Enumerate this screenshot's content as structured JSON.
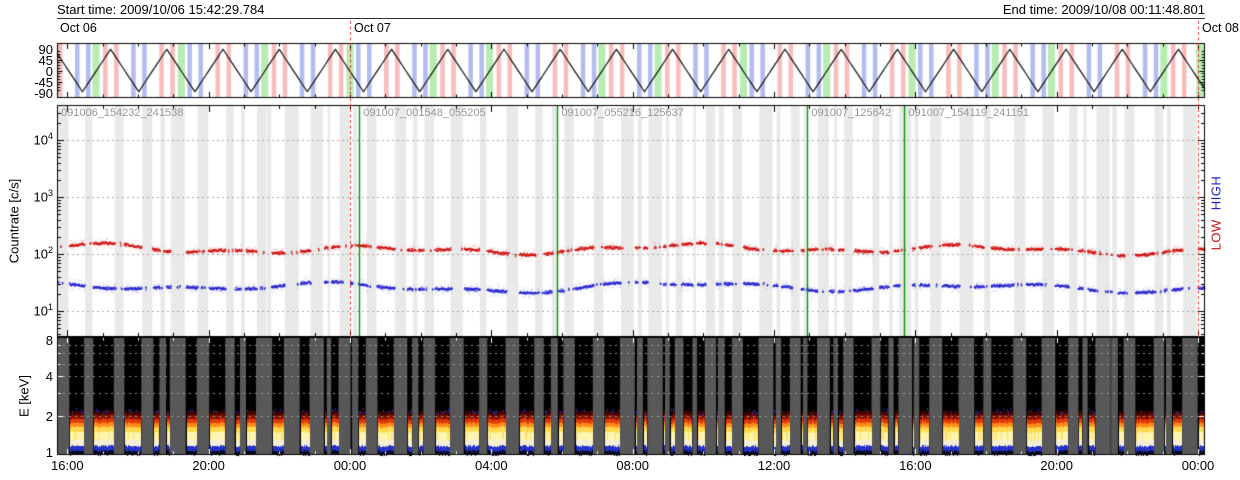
{
  "title_bar": {
    "start": "Start time: 2009/10/06 15:42:29.784",
    "end": "End time: 2009/10/08 00:11:48.801"
  },
  "legend": {
    "low": "LOW",
    "high": "HIGH",
    "low_color": "#cc1111",
    "high_color": "#2222cc"
  },
  "axis_titles": {
    "countrate": "Countrate [c/s]",
    "energy": "E [keV]"
  },
  "chart_data": {
    "type": "multi-panel-timeseries",
    "x_axis": {
      "start_time": "2009/10/06 15:42:29.784",
      "end_time": "2009/10/08 00:11:48.801",
      "total_hours": 32.4886,
      "tick_labels": [
        "16:00",
        "20:00",
        "00:00",
        "04:00",
        "08:00",
        "12:00",
        "16:00",
        "20:00",
        "00:00"
      ],
      "tick_hours": [
        0.2917,
        4.2917,
        8.2917,
        12.2917,
        16.2917,
        20.2917,
        24.2917,
        28.2917,
        32.2917
      ],
      "minor_tick_every_hours": 1,
      "start_day_label": "Oct 06",
      "day_boundaries": [
        {
          "label": "Oct 07",
          "hours": 8.2917
        },
        {
          "label": "Oct 08",
          "hours": 32.2917
        }
      ],
      "day_line_color": "#e04040"
    },
    "panels": [
      {
        "name": "scan_angle",
        "type": "line",
        "ylim": [
          -90,
          90
        ],
        "ytick_labels": [
          "90",
          "45",
          "0",
          "-45",
          "-90"
        ],
        "ytick_values": [
          90,
          45,
          0,
          -45,
          -90
        ],
        "wave": {
          "shape": "triangle",
          "amplitude_deg": 87,
          "period_hours": 1.5905,
          "first_peak_hour": -0.0736,
          "color": "#111111"
        },
        "band_colors": {
          "blue": "#b3bcef",
          "pink": "#f8bcbc",
          "green": "#b9ecb2"
        },
        "edge_band": {
          "color": "green",
          "from_hour": 32.24,
          "to_hour": 32.4886
        }
      },
      {
        "name": "countrate",
        "type": "scatter",
        "yscale": "log",
        "ytick_base": "10",
        "ytick_exponents": [
          "4",
          "3",
          "2",
          "1"
        ],
        "series": [
          {
            "name": "LOW",
            "color": "#d01414",
            "mean_level_cps": 125
          },
          {
            "name": "HIGH",
            "color": "#2424d0",
            "mean_level_cps": 27
          }
        ],
        "gap_color": "#e9e9e9",
        "grid_color": "#aaaaaa",
        "file_line_color": "#009400",
        "file_intervals": [
          {
            "label": "091006_154232_241538",
            "start_hours": 0
          },
          {
            "label": "091007_001548_055205",
            "start_hours": 8.5551
          },
          {
            "label": "091007_055216_125637",
            "start_hours": 14.1628
          },
          {
            "label": "091007_125642",
            "start_hours": 21.2367
          },
          {
            "label": "091007_154119_241151",
            "start_hours": 23.9803
          }
        ],
        "file_label_color": "#999999"
      },
      {
        "name": "spectrogram",
        "type": "heatmap",
        "ylim_kev": [
          1,
          8
        ],
        "ytick_labels": [
          "8",
          "4",
          "2",
          "1"
        ],
        "ytick_values": [
          8,
          4,
          2,
          1
        ],
        "emission_band_kev": [
          1.1,
          2.1
        ],
        "background": "#000000",
        "gap_color": "#585858",
        "palette_bottom_to_top": [
          "#0a0a20",
          "#2433cc",
          "#f5efd5",
          "#fdf6b0",
          "#ffd84e",
          "#ff8c1a",
          "#e03a08",
          "#8b1200",
          "#3a0500"
        ],
        "grid_color": "#b0b0b0"
      }
    ]
  }
}
